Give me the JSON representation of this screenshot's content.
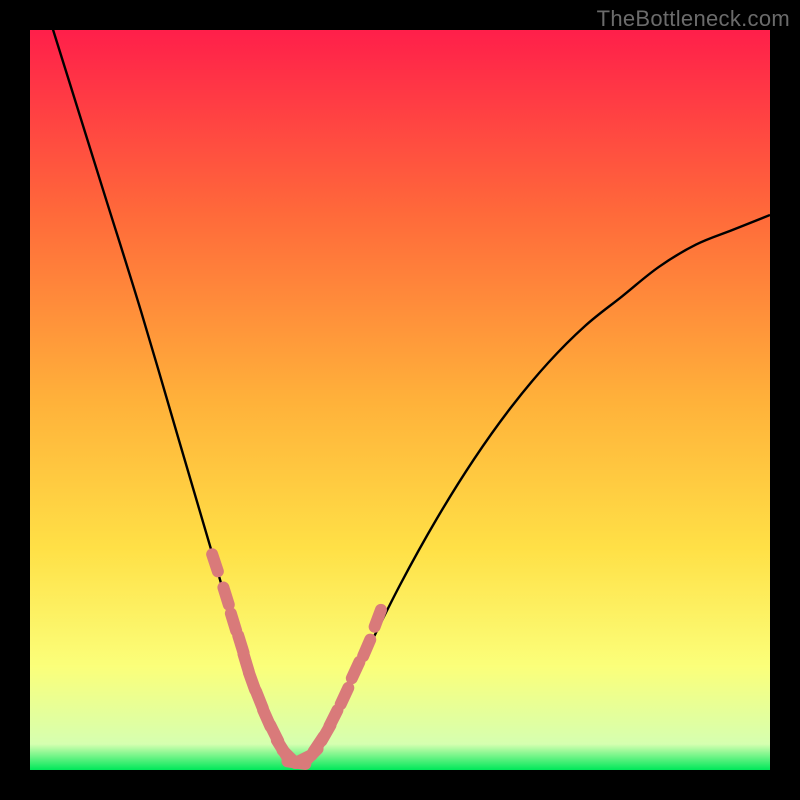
{
  "watermark": "TheBottleneck.com",
  "colors": {
    "bg": "#000000",
    "grad_top": "#ff1f4a",
    "grad_mid1": "#ff8a3a",
    "grad_mid2": "#ffe046",
    "grad_mid3": "#fbff7a",
    "grad_green": "#00e85a",
    "curve": "#000000",
    "marker_fill": "#d97a7a",
    "marker_stroke": "#c46b6b"
  },
  "chart_data": {
    "type": "line",
    "title": "",
    "xlabel": "",
    "ylabel": "",
    "x_range": [
      0,
      100
    ],
    "y_range": [
      0,
      100
    ],
    "description": "Bottleneck V-curve: steep descending left branch, minimum near x≈36, rising right branch that tapers toward upper right.",
    "series": [
      {
        "name": "bottleneck-curve",
        "x": [
          0,
          5,
          10,
          15,
          20,
          25,
          28,
          30,
          32,
          34,
          36,
          38,
          40,
          42,
          45,
          50,
          55,
          60,
          65,
          70,
          75,
          80,
          85,
          90,
          95,
          100
        ],
        "y": [
          110,
          94,
          78,
          62,
          45,
          28,
          18,
          12,
          7,
          3,
          1,
          2,
          5,
          9,
          15,
          25,
          34,
          42,
          49,
          55,
          60,
          64,
          68,
          71,
          73,
          75
        ]
      }
    ],
    "markers": {
      "name": "highlighted-points",
      "x": [
        25.0,
        26.5,
        27.5,
        28.5,
        29.2,
        30.0,
        31.0,
        32.0,
        33.0,
        34.0,
        35.0,
        36.0,
        37.0,
        38.0,
        39.0,
        40.0,
        41.0,
        42.5,
        44.0,
        45.5,
        47.0
      ],
      "y": [
        28.0,
        23.5,
        20.0,
        17.0,
        14.5,
        12.0,
        9.5,
        7.0,
        5.0,
        3.0,
        1.8,
        1.0,
        1.5,
        2.0,
        3.5,
        5.0,
        7.0,
        10.0,
        13.5,
        16.5,
        20.5
      ]
    },
    "gradient_stops": [
      {
        "offset": 0.0,
        "color": "#ff1f4a"
      },
      {
        "offset": 0.25,
        "color": "#ff6a3a"
      },
      {
        "offset": 0.5,
        "color": "#ffb13a"
      },
      {
        "offset": 0.7,
        "color": "#ffe046"
      },
      {
        "offset": 0.86,
        "color": "#fbff7a"
      },
      {
        "offset": 0.965,
        "color": "#d6ffb0"
      },
      {
        "offset": 1.0,
        "color": "#00e85a"
      }
    ]
  }
}
